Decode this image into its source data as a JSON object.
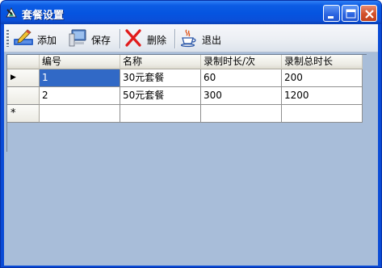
{
  "window": {
    "title": "套餐设置"
  },
  "toolbar": {
    "add_label": "添加",
    "save_label": "保存",
    "delete_label": "删除",
    "exit_label": "退出"
  },
  "grid": {
    "columns": [
      "编号",
      "名称",
      "录制时长/次",
      "录制总时长"
    ],
    "rows": [
      {
        "id": "1",
        "name": "30元套餐",
        "duration_per": "60",
        "total": "200"
      },
      {
        "id": "2",
        "name": "50元套餐",
        "duration_per": "300",
        "total": "1200"
      }
    ],
    "current_row_marker": "▶",
    "new_row_marker": "*"
  },
  "colors": {
    "title_bar": "#0554e0",
    "client_bg": "#a8bdd9",
    "selection": "#3169c6"
  }
}
